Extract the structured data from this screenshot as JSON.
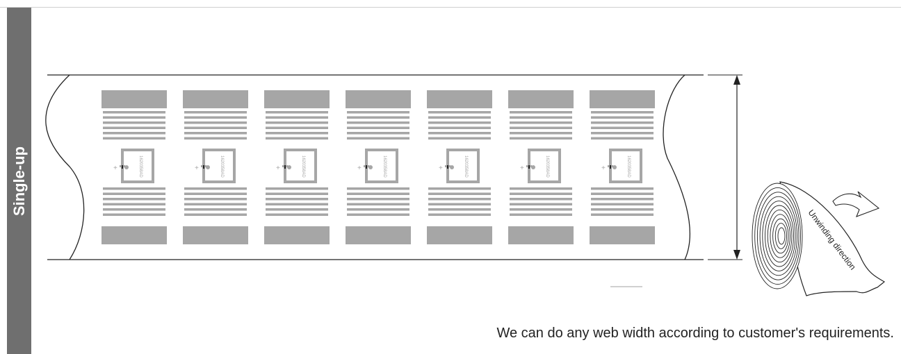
{
  "side_tab": {
    "label": "Single-up"
  },
  "web": {
    "label_count": 7,
    "chip_code": "1620358AD",
    "chip_marker": "+"
  },
  "roll": {
    "direction_text": "Unwinding direction"
  },
  "footnote": "We can do any web width according to customer's requirements.",
  "colors": {
    "side_tab": "#6f6f6f",
    "antenna": "#a6a6a6",
    "outline": "#222222"
  }
}
